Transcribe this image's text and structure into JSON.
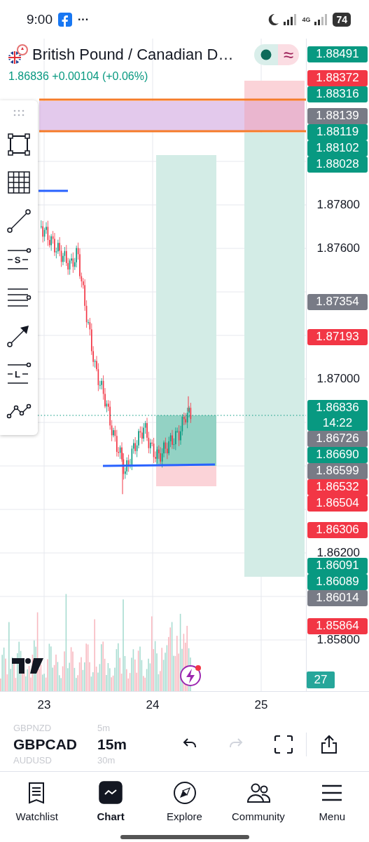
{
  "status_bar": {
    "time": "9:00",
    "more": "···",
    "network": "4G",
    "battery": "74"
  },
  "header": {
    "symbol": "British Pound / Canadian D…",
    "price_change": "1.86836 +0.00104 (+0.06%)",
    "market_status": "≈"
  },
  "toolbar": [
    {
      "kind": "handle"
    },
    {
      "kind": "rectangle"
    },
    {
      "kind": "grid"
    },
    {
      "kind": "line"
    },
    {
      "kind": "levels",
      "letter": "S"
    },
    {
      "kind": "lines"
    },
    {
      "kind": "arrow"
    },
    {
      "kind": "levels",
      "letter": "L"
    },
    {
      "kind": "path"
    }
  ],
  "price_axis": {
    "ticks": [
      "1.87800",
      "1.87600",
      "1.87000",
      "1.86200",
      "1.85800"
    ],
    "labels": [
      {
        "price": "1.88491",
        "color": "#089981"
      },
      {
        "price": "1.88372",
        "color": "#f23645"
      },
      {
        "price": "1.88316",
        "color": "#089981"
      },
      {
        "price": "1.88139",
        "color": "#787b86"
      },
      {
        "price": "1.88119",
        "color": "#089981"
      },
      {
        "price": "1.88102",
        "color": "#089981"
      },
      {
        "price": "1.88028",
        "color": "#089981"
      },
      {
        "price": "1.87354",
        "color": "#787b86"
      },
      {
        "price": "1.87193",
        "color": "#f23645"
      },
      {
        "price": "1.86836",
        "countdown": "14:22",
        "color": "#089981"
      },
      {
        "price": "1.86726",
        "color": "#787b86"
      },
      {
        "price": "1.86690",
        "color": "#089981"
      },
      {
        "price": "1.86599",
        "color": "#787b86"
      },
      {
        "price": "1.86532",
        "color": "#f23645"
      },
      {
        "price": "1.86504",
        "color": "#f23645"
      },
      {
        "price": "1.86306",
        "color": "#f23645"
      },
      {
        "price": "1.86091",
        "color": "#089981"
      },
      {
        "price": "1.86089",
        "color": "#089981"
      },
      {
        "price": "1.86014",
        "color": "#787b86"
      },
      {
        "price": "1.85864",
        "color": "#f23645"
      }
    ],
    "volume_label": "27"
  },
  "time_axis": [
    "23",
    "24",
    "25"
  ],
  "symbol_picker": [
    {
      "symbol": "GBPNZD",
      "interval": "5m",
      "selected": false
    },
    {
      "symbol": "GBPCAD",
      "interval": "15m",
      "selected": true
    },
    {
      "symbol": "AUDUSD",
      "interval": "30m",
      "selected": false
    }
  ],
  "actions": [
    {
      "kind": "undo",
      "disabled": false
    },
    {
      "kind": "redo",
      "disabled": true
    },
    {
      "kind": "fullscreen",
      "disabled": false
    },
    {
      "kind": "share",
      "disabled": false
    }
  ],
  "tabs": [
    {
      "label": "Watchlist",
      "kind": "watchlist",
      "selected": false
    },
    {
      "label": "Chart",
      "kind": "chart",
      "selected": true
    },
    {
      "label": "Explore",
      "kind": "explore",
      "selected": false
    },
    {
      "label": "Community",
      "kind": "community",
      "selected": false
    },
    {
      "label": "Menu",
      "kind": "menu",
      "selected": false
    }
  ]
}
